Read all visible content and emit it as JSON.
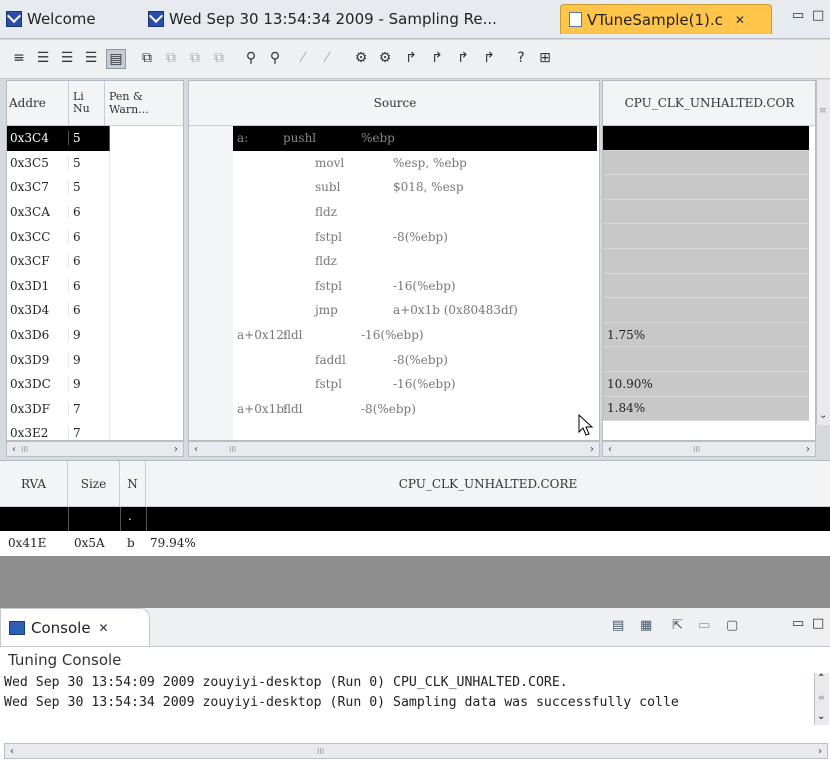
{
  "tabs": [
    {
      "label": "Welcome"
    },
    {
      "label": "Wed Sep 30 13:54:34 2009 - Sampling Re..."
    },
    {
      "label": "VTuneSample(1).c"
    }
  ],
  "left_table": {
    "headers": [
      "Addre",
      "Li Nu",
      "Pen & Warn..."
    ],
    "rows": [
      {
        "addr": "0x3C4",
        "line": "5"
      },
      {
        "addr": "0x3C5",
        "line": "5"
      },
      {
        "addr": "0x3C7",
        "line": "5"
      },
      {
        "addr": "0x3CA",
        "line": "6"
      },
      {
        "addr": "0x3CC",
        "line": "6"
      },
      {
        "addr": "0x3CF",
        "line": "6"
      },
      {
        "addr": "0x3D1",
        "line": "6"
      },
      {
        "addr": "0x3D4",
        "line": "6"
      },
      {
        "addr": "0x3D6",
        "line": "9"
      },
      {
        "addr": "0x3D9",
        "line": "9"
      },
      {
        "addr": "0x3DC",
        "line": "9"
      },
      {
        "addr": "0x3DF",
        "line": "7"
      },
      {
        "addr": "0x3E2",
        "line": "7"
      }
    ]
  },
  "source_pane": {
    "header": "Source",
    "lines": [
      {
        "label": "a:",
        "op": "pushl",
        "args": "%ebp"
      },
      {
        "label": "",
        "op": "movl",
        "args": "%esp, %ebp"
      },
      {
        "label": "",
        "op": "subl",
        "args": "$018, %esp"
      },
      {
        "label": "",
        "op": "fldz",
        "args": ""
      },
      {
        "label": "",
        "op": "fstpl",
        "args": "-8(%ebp)"
      },
      {
        "label": "",
        "op": "fldz",
        "args": ""
      },
      {
        "label": "",
        "op": "fstpl",
        "args": "-16(%ebp)"
      },
      {
        "label": "",
        "op": "jmp",
        "args": "a+0x1b (0x80483df)"
      },
      {
        "label": "a+0x12:",
        "op": "fldl",
        "args": "-16(%ebp)"
      },
      {
        "label": "",
        "op": "faddl",
        "args": "-8(%ebp)"
      },
      {
        "label": "",
        "op": "fstpl",
        "args": "-16(%ebp)"
      },
      {
        "label": "a+0x1b:",
        "op": "fldl",
        "args": "-8(%ebp)"
      }
    ]
  },
  "metric_pane": {
    "header": "CPU_CLK_UNHALTED.COR",
    "values": [
      "",
      "",
      "",
      "",
      "",
      "",
      "",
      "",
      "1.75%",
      "",
      "10.90%",
      "1.84%"
    ]
  },
  "bottom_table": {
    "headers": [
      "RVA",
      "Size",
      "N",
      "CPU_CLK_UNHALTED.CORE"
    ],
    "row": {
      "rva": "0x41E",
      "size": "0x5A",
      "n": "b",
      "value": "79.94%"
    },
    "selected_dot": "."
  },
  "console": {
    "tab_label": "Console",
    "title": "Tuning Console",
    "lines": [
      "Wed Sep 30 13:54:09 2009 zouyiyi-desktop (Run 0) CPU_CLK_UNHALTED.CORE.",
      "Wed Sep 30 13:54:34 2009 zouyiyi-desktop (Run 0) Sampling data was successfully colle"
    ]
  },
  "scroll": {
    "grip": "III"
  },
  "colors": {
    "accent_tab": "#ffc44a",
    "selection": "#000000",
    "metric_bg": "#c8c8c8"
  }
}
